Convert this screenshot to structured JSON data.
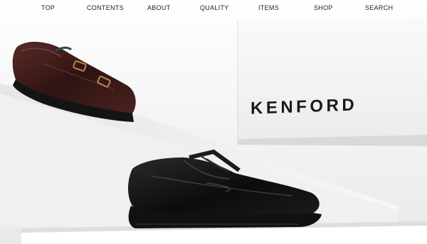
{
  "nav": {
    "items": [
      {
        "label": "TOP"
      },
      {
        "label": "CONTENTS"
      },
      {
        "label": "ABOUT"
      },
      {
        "label": "QUALITY"
      },
      {
        "label": "ITEMS"
      },
      {
        "label": "SHOP"
      },
      {
        "label": "SEARCH"
      }
    ]
  },
  "hero": {
    "brand_text": "KENFORD",
    "colors": {
      "background": "#f2f2f2",
      "steps": "#ffffff",
      "monk_strap_shoe": "#3a1c1a",
      "derby_shoe": "#0f0f0f",
      "buckle": "#b8864b"
    }
  }
}
